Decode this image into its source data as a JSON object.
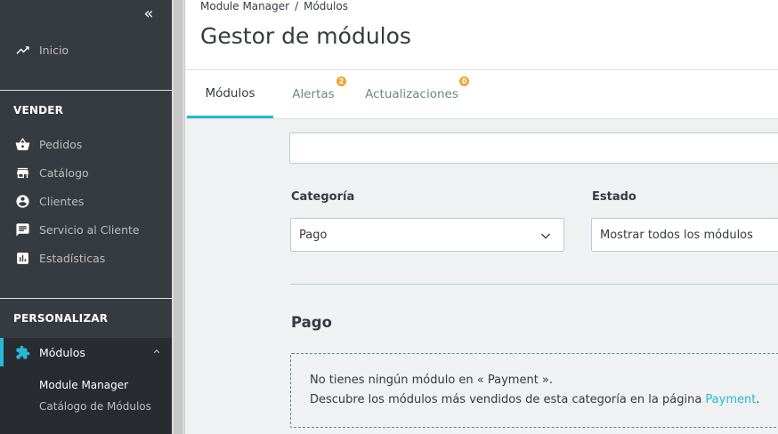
{
  "sidebar": {
    "home_label": "Inicio",
    "sections": {
      "sell_title": "VENDER",
      "customize_title": "PERSONALIZAR"
    },
    "sell_items": [
      {
        "label": "Pedidos",
        "icon": "shopping-basket-icon"
      },
      {
        "label": "Catálogo",
        "icon": "store-icon"
      },
      {
        "label": "Clientes",
        "icon": "account-circle-icon"
      },
      {
        "label": "Servicio al Cliente",
        "icon": "chat-icon"
      },
      {
        "label": "Estadísticas",
        "icon": "stats-chart-icon"
      }
    ],
    "active_item": {
      "label": "Módulos",
      "icon": "puzzle-icon"
    },
    "sub_items": [
      {
        "label": "Module Manager"
      },
      {
        "label": "Catálogo de Módulos"
      }
    ],
    "accent_color": "#25b9d7"
  },
  "header": {
    "breadcrumb": [
      "Module Manager",
      "/",
      "Módulos"
    ],
    "title": "Gestor de módulos",
    "tabs": [
      {
        "label": "Módulos"
      },
      {
        "label": "Alertas",
        "badge": "2"
      },
      {
        "label": "Actualizaciones",
        "badge": "0"
      }
    ]
  },
  "filters": {
    "search_placeholder": "",
    "category_label": "Categoría",
    "category_value": "Pago",
    "status_label": "Estado",
    "status_value": "Mostrar todos los módulos"
  },
  "section": {
    "title": "Pago",
    "empty_line1": "No tienes ningún módulo en « Payment ».",
    "empty_line2_prefix": "Descubre los módulos más vendidos de esta categoría en la página ",
    "empty_link": "Payment",
    "empty_line2_suffix": "."
  }
}
